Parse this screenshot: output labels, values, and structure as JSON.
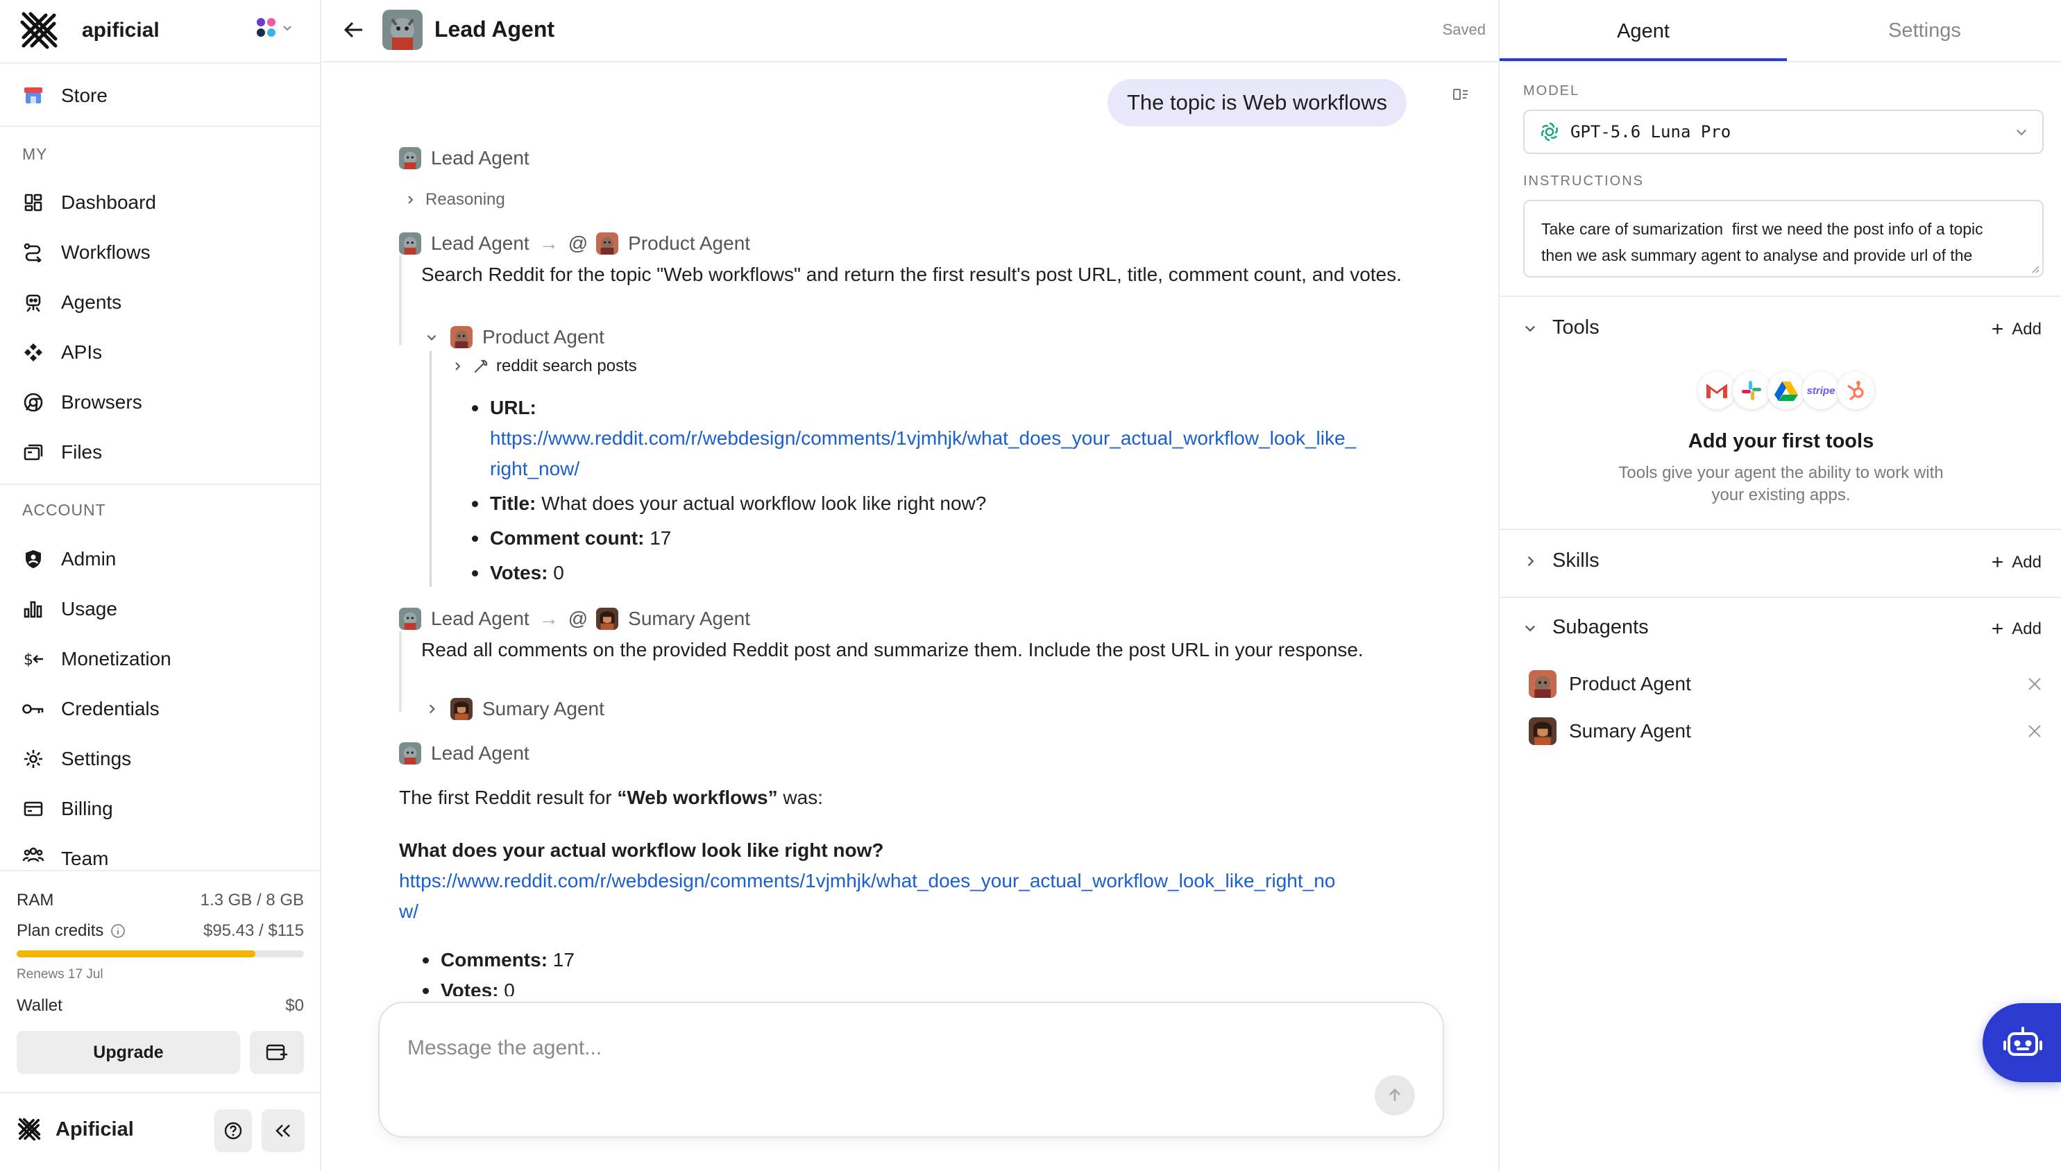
{
  "sidebar": {
    "org_name": "apificial",
    "store_label": "Store",
    "my_heading": "MY",
    "my_items": [
      {
        "label": "Dashboard",
        "icon": "dashboard-icon"
      },
      {
        "label": "Workflows",
        "icon": "workflows-icon"
      },
      {
        "label": "Agents",
        "icon": "agents-icon"
      },
      {
        "label": "APIs",
        "icon": "apis-icon"
      },
      {
        "label": "Browsers",
        "icon": "browsers-icon"
      },
      {
        "label": "Files",
        "icon": "files-icon"
      }
    ],
    "account_heading": "ACCOUNT",
    "account_items": [
      {
        "label": "Admin",
        "icon": "admin-icon"
      },
      {
        "label": "Usage",
        "icon": "usage-icon"
      },
      {
        "label": "Monetization",
        "icon": "monetization-icon"
      },
      {
        "label": "Credentials",
        "icon": "credentials-icon"
      },
      {
        "label": "Settings",
        "icon": "settings-icon"
      },
      {
        "label": "Billing",
        "icon": "billing-icon"
      },
      {
        "label": "Team",
        "icon": "team-icon"
      }
    ],
    "resources": {
      "ram_label": "RAM",
      "ram_value": "1.3 GB / 8 GB",
      "credits_label": "Plan credits",
      "credits_value": "$95.43 / $115",
      "credits_fraction": 0.83,
      "renews": "Renews 17 Jul",
      "wallet_label": "Wallet",
      "wallet_value": "$0",
      "upgrade_label": "Upgrade"
    },
    "footer_brand": "Apificial"
  },
  "header": {
    "title": "Lead Agent",
    "status": "Saved"
  },
  "chat": {
    "user_message": "The topic is Web workflows",
    "lead_agent_name": "Lead Agent",
    "reasoning_label": "Reasoning",
    "delegation_1": {
      "from": "Lead Agent",
      "arrow": "→",
      "at": "@",
      "to": "Product Agent",
      "task": "Search Reddit for the topic \"Web workflows\" and return the first result's post URL, title, comment count, and votes.",
      "sub_agent": "Product Agent",
      "tool_call": "reddit search posts",
      "result": {
        "url_label": "URL:",
        "url": "https://www.reddit.com/r/webdesign/comments/1vjmhjk/what_does_your_actual_workflow_look_like_right_now/",
        "url_line1": "https://www.reddit.com/r/webdesign/comments/1vjmhjk/what_does_your_actual_workflow_look_like_",
        "url_line2": "right_now/",
        "title_label": "Title:",
        "title_value": " What does your actual workflow look like right now?",
        "comments_label": "Comment count:",
        "comments_value": " 17",
        "votes_label": "Votes:",
        "votes_value": " 0"
      }
    },
    "delegation_2": {
      "from": "Lead Agent",
      "arrow": "→",
      "at": "@",
      "to": "Sumary Agent",
      "task": "Read all comments on the provided Reddit post and summarize them. Include the post URL in your response.",
      "sub_agent": "Sumary Agent"
    },
    "final": {
      "author": "Lead Agent",
      "intro_prefix": "The first Reddit result for ",
      "intro_bold": "“Web workflows”",
      "intro_suffix": " was:",
      "post_title": "What does your actual workflow look like right now?",
      "url_line1": "https://www.reddit.com/r/webdesign/comments/1vjmhjk/what_does_your_actual_workflow_look_like_right_no",
      "url_line2": "w/",
      "comments_label": "Comments:",
      "comments_value": " 17",
      "votes_label": "Votes:",
      "votes_value": " 0"
    },
    "input_placeholder": "Message the agent..."
  },
  "panel": {
    "tabs": [
      "Agent",
      "Settings"
    ],
    "active_tab": "Agent",
    "model_label": "MODEL",
    "model_value": "GPT-5.6 Luna Pro",
    "instructions_label": "INSTRUCTIONS",
    "instructions_line1": "Take care of sumarization  first we need the post info of a topic",
    "instructions_line2": "then we ask summary agent to analyse and provide url of the",
    "tools_title": "Tools",
    "add_label": "Add",
    "tools_empty_title": "Add your first tools",
    "tools_empty_desc_line1": "Tools give your agent the ability to work with",
    "tools_empty_desc_line2": "your existing apps.",
    "tool_logos": [
      "gmail",
      "slack",
      "google-drive",
      "stripe",
      "hubspot"
    ],
    "stripe_text": "stripe",
    "skills_title": "Skills",
    "subagents_title": "Subagents",
    "subagents": [
      "Product Agent",
      "Sumary Agent"
    ]
  },
  "colors": {
    "accent": "#2b3bd0",
    "user_bubble": "#e9e8fb",
    "link": "#1a5fd0",
    "credits_bar": "#f5b400"
  }
}
